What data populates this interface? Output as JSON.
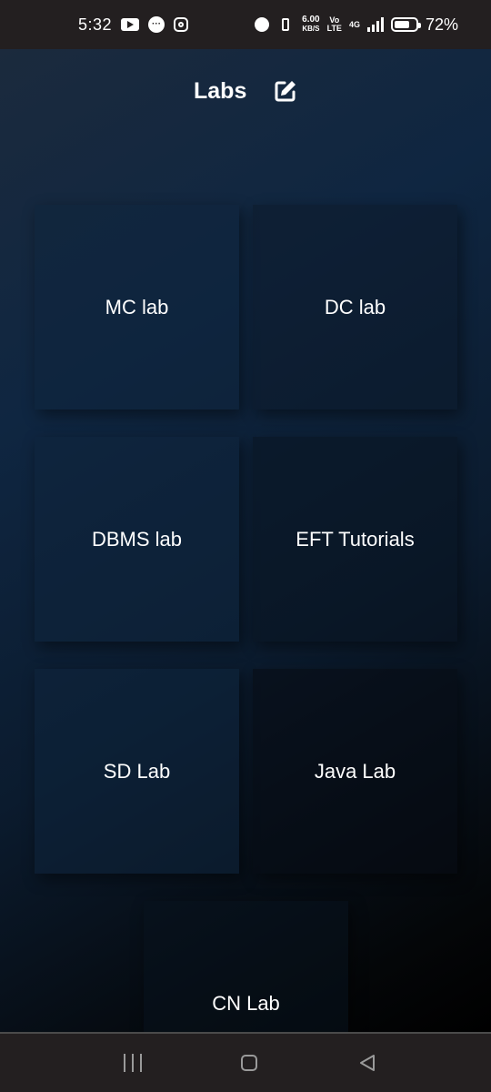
{
  "status_bar": {
    "time": "5:32",
    "net_speed_value": "6.00",
    "net_speed_unit": "KB/S",
    "volte_top": "Vo",
    "volte_bottom": "LTE",
    "network_type": "4G",
    "battery_percent": "72%",
    "battery_level": 0.72,
    "icons": [
      "youtube-icon",
      "messages-icon",
      "instagram-icon",
      "alarm-icon",
      "vibrate-icon",
      "signal-icon",
      "battery-icon"
    ]
  },
  "app_bar": {
    "title": "Labs",
    "edit_icon": "edit-icon"
  },
  "labs": [
    {
      "label": "MC lab"
    },
    {
      "label": "DC lab"
    },
    {
      "label": "DBMS lab"
    },
    {
      "label": "EFT Tutorials"
    },
    {
      "label": "SD Lab"
    },
    {
      "label": "Java Lab"
    },
    {
      "label": "CN Lab"
    }
  ],
  "nav_bar": {
    "icons": [
      "recent-apps-icon",
      "home-icon",
      "back-icon"
    ]
  },
  "colors": {
    "status_bar_bg": "#231f20",
    "background_start": "#1b2a3d",
    "background_end": "#000000",
    "text": "#ffffff"
  }
}
